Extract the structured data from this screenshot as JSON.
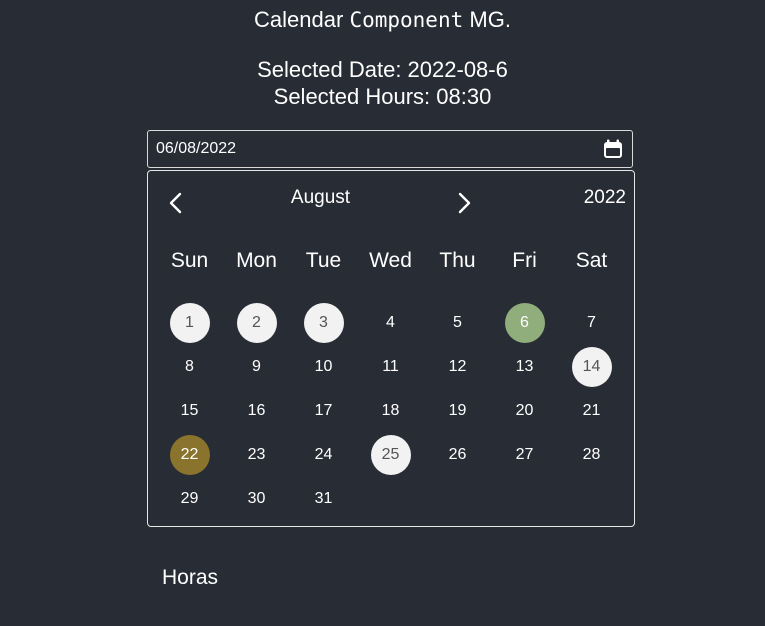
{
  "header": {
    "title_prefix": "Calendar",
    "title_code": "Component",
    "title_suffix": "MG."
  },
  "selected": {
    "date_text": "Selected Date: 2022-08-6",
    "hours_text": "Selected Hours: 08:30"
  },
  "date_input": {
    "value": "06/08/2022",
    "icon": "calendar-icon"
  },
  "calendar": {
    "month": "August",
    "year": "2022",
    "prev_icon": "chevron-left-icon",
    "next_icon": "chevron-right-icon",
    "weekdays": [
      "Sun",
      "Mon",
      "Tue",
      "Wed",
      "Thu",
      "Fri",
      "Sat"
    ],
    "days": [
      {
        "label": "1",
        "state": "marked"
      },
      {
        "label": "2",
        "state": "marked"
      },
      {
        "label": "3",
        "state": "marked"
      },
      {
        "label": "4",
        "state": "normal"
      },
      {
        "label": "5",
        "state": "normal"
      },
      {
        "label": "6",
        "state": "selected"
      },
      {
        "label": "7",
        "state": "normal"
      },
      {
        "label": "8",
        "state": "normal"
      },
      {
        "label": "9",
        "state": "normal"
      },
      {
        "label": "10",
        "state": "normal"
      },
      {
        "label": "11",
        "state": "normal"
      },
      {
        "label": "12",
        "state": "normal"
      },
      {
        "label": "13",
        "state": "normal"
      },
      {
        "label": "14",
        "state": "marked"
      },
      {
        "label": "15",
        "state": "normal"
      },
      {
        "label": "16",
        "state": "normal"
      },
      {
        "label": "17",
        "state": "normal"
      },
      {
        "label": "18",
        "state": "normal"
      },
      {
        "label": "19",
        "state": "normal"
      },
      {
        "label": "20",
        "state": "normal"
      },
      {
        "label": "21",
        "state": "normal"
      },
      {
        "label": "22",
        "state": "holiday"
      },
      {
        "label": "23",
        "state": "normal"
      },
      {
        "label": "24",
        "state": "normal"
      },
      {
        "label": "25",
        "state": "marked"
      },
      {
        "label": "26",
        "state": "normal"
      },
      {
        "label": "27",
        "state": "normal"
      },
      {
        "label": "28",
        "state": "normal"
      },
      {
        "label": "29",
        "state": "normal"
      },
      {
        "label": "30",
        "state": "normal"
      },
      {
        "label": "31",
        "state": "normal"
      }
    ]
  },
  "hours_section": {
    "label": "Horas"
  },
  "colors": {
    "background": "#282c34",
    "marked": "#f2f2f2",
    "selected": "#8fae7b",
    "holiday": "#8a732c"
  }
}
